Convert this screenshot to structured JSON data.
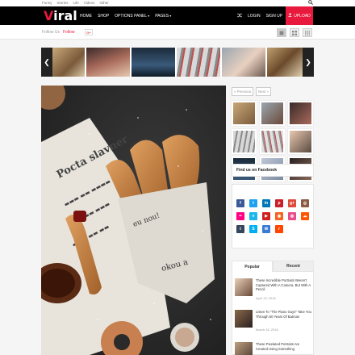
{
  "topbar": {
    "links": [
      "Funny",
      "Stories",
      "Life",
      "Videos",
      "Other"
    ],
    "search_icon": "search-icon"
  },
  "navbar": {
    "logo_first": "V",
    "logo_rest": "iral",
    "menu": [
      "HOME",
      "SHOP",
      "OPTIONS PANEL",
      "PAGES"
    ],
    "shuffle_icon": "shuffle-icon",
    "login": "LOGIN",
    "signup": "SIGN UP",
    "upload": "UPLOAD",
    "accent": "#e8193c"
  },
  "followbar": {
    "label": "Follow Us",
    "link": "Follow",
    "gplus": "G+"
  },
  "carousel": {
    "prev": "❮",
    "next": "❯"
  },
  "sidebar": {
    "previous": "« Previous",
    "next": "Next »",
    "facebook_title": "Find us on Facebook",
    "social_icons": [
      {
        "name": "facebook",
        "glyph": "f",
        "color": "#3b5998"
      },
      {
        "name": "twitter",
        "glyph": "t",
        "color": "#1da1f2"
      },
      {
        "name": "linkedin",
        "glyph": "in",
        "color": "#0077b5"
      },
      {
        "name": "pinterest",
        "glyph": "p",
        "color": "#cb2027"
      },
      {
        "name": "google-plus",
        "glyph": "g+",
        "color": "#dd4b39"
      },
      {
        "name": "instagram",
        "glyph": "◎",
        "color": "#8a5a44"
      },
      {
        "name": "flickr",
        "glyph": "••",
        "color": "#ff0084"
      },
      {
        "name": "vimeo",
        "glyph": "v",
        "color": "#1ab7ea"
      },
      {
        "name": "youtube",
        "glyph": "▶",
        "color": "#cd201f"
      },
      {
        "name": "rss",
        "glyph": "◉",
        "color": "#f26522"
      },
      {
        "name": "dribbble",
        "glyph": "◍",
        "color": "#ea4c89"
      },
      {
        "name": "soundcloud",
        "glyph": "☁",
        "color": "#ff5500"
      },
      {
        "name": "tumblr",
        "glyph": "t",
        "color": "#35465c"
      },
      {
        "name": "skype",
        "glyph": "S",
        "color": "#00aff0"
      },
      {
        "name": "email",
        "glyph": "✉",
        "color": "#3a7bd5"
      },
      {
        "name": "reddit",
        "glyph": "r",
        "color": "#ff4500"
      }
    ],
    "tabs": [
      "Popular",
      "Recent"
    ],
    "posts": [
      {
        "title": "These Incredible Portraits Weren't Captured With A Camera, But With A Pencil",
        "date": "April 13, 2016"
      },
      {
        "title": "Listen To \"The Piano Guys\" Take You Through 50 Years Of Batman",
        "date": "March 16, 2016"
      },
      {
        "title": "These Pixelated Portraits Are Created Using Something",
        "date": ""
      }
    ]
  }
}
